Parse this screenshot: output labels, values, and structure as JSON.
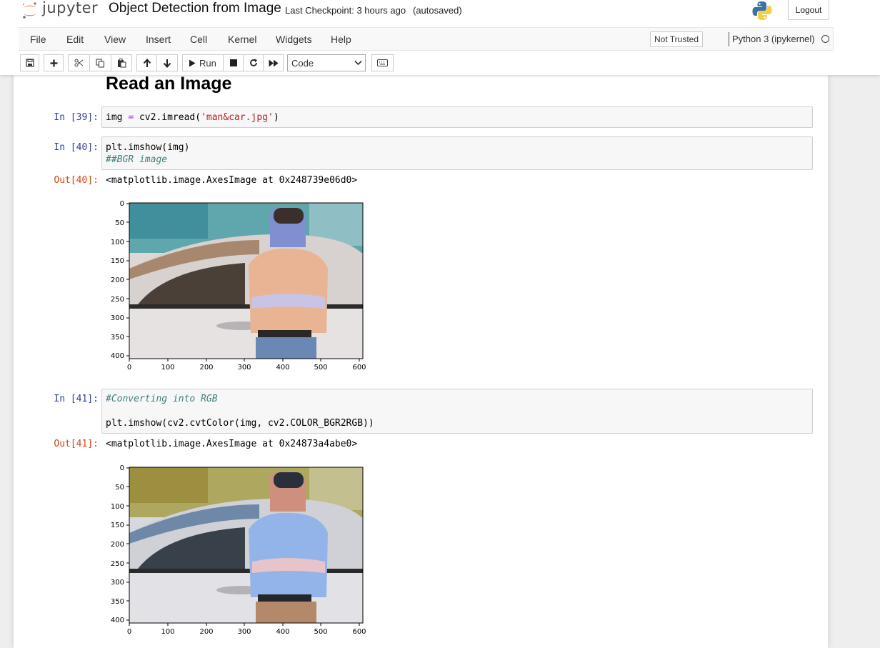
{
  "header": {
    "logo_text": "jupyter",
    "notebook_title": "Object Detection from Image",
    "checkpoint": "Last Checkpoint: 3 hours ago",
    "autosave_status": "(autosaved)",
    "logout_label": "Logout"
  },
  "menubar": {
    "items": [
      "File",
      "Edit",
      "View",
      "Insert",
      "Cell",
      "Kernel",
      "Widgets",
      "Help"
    ],
    "trust_label": "Not Trusted",
    "kernel_name": "Python 3 (ipykernel)"
  },
  "toolbar": {
    "run_label": "Run",
    "cell_type": "Code",
    "icons": [
      "save-icon",
      "plus-icon",
      "scissors-icon",
      "copy-icon",
      "paste-icon",
      "arrow-up-icon",
      "arrow-down-icon",
      "play-icon",
      "stop-icon",
      "restart-icon",
      "fast-forward-icon",
      "keyboard-icon"
    ]
  },
  "notebook": {
    "heading": "Read an Image",
    "cells": [
      {
        "in_prompt": "In [39]:",
        "code": [
          "img = cv2.imread('man&car.jpg')"
        ]
      },
      {
        "in_prompt": "In [40]:",
        "code": [
          "plt.imshow(img)",
          "##BGR image"
        ],
        "out_prompt": "Out[40]:",
        "output": "<matplotlib.image.AxesImage at 0x248739e06d0>",
        "plot": {
          "mode": "BGR",
          "x_ticks": [
            "0",
            "100",
            "200",
            "300",
            "400",
            "500",
            "600"
          ],
          "y_ticks": [
            "0",
            "50",
            "100",
            "150",
            "200",
            "250",
            "300",
            "350",
            "400"
          ]
        }
      },
      {
        "in_prompt": "In [41]:",
        "code": [
          "#Converting into RGB",
          "",
          "plt.imshow(cv2.cvtColor(img, cv2.COLOR_BGR2RGB))"
        ],
        "out_prompt": "Out[41]:",
        "output": "<matplotlib.image.AxesImage at 0x24873a4abe0>",
        "plot": {
          "mode": "RGB",
          "x_ticks": [
            "0",
            "100",
            "200",
            "300",
            "400",
            "500",
            "600"
          ],
          "y_ticks": [
            "0",
            "50",
            "100",
            "150",
            "200",
            "250",
            "300",
            "350",
            "400"
          ]
        }
      }
    ]
  },
  "colors": {
    "in_prompt": "#303f9f",
    "out_prompt": "#d84315",
    "string": "#ba2121",
    "comment": "#408080",
    "operator": "#aa22ff"
  }
}
